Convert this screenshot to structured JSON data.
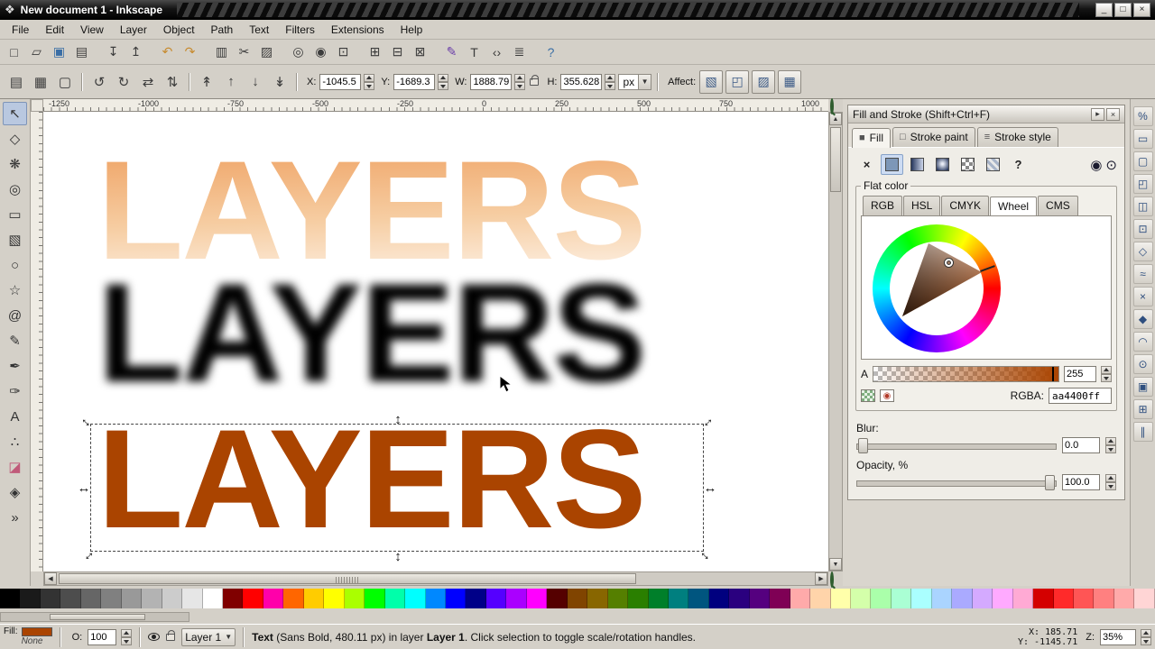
{
  "window": {
    "title": "New document 1 - Inkscape",
    "icon_glyph": "❖",
    "controls": [
      {
        "name": "minimize-button",
        "glyph": "_"
      },
      {
        "name": "restore-button",
        "glyph": "□"
      },
      {
        "name": "close-button",
        "glyph": "×"
      }
    ]
  },
  "menu": {
    "items": [
      {
        "name": "menu-file",
        "label": "File"
      },
      {
        "name": "menu-edit",
        "label": "Edit"
      },
      {
        "name": "menu-view",
        "label": "View"
      },
      {
        "name": "menu-layer",
        "label": "Layer"
      },
      {
        "name": "menu-object",
        "label": "Object"
      },
      {
        "name": "menu-path",
        "label": "Path"
      },
      {
        "name": "menu-text",
        "label": "Text"
      },
      {
        "name": "menu-filters",
        "label": "Filters"
      },
      {
        "name": "menu-extensions",
        "label": "Extensions"
      },
      {
        "name": "menu-help",
        "label": "Help"
      }
    ]
  },
  "toolbar1": {
    "items": [
      {
        "name": "new-document-button",
        "glyph": "□"
      },
      {
        "name": "open-button",
        "glyph": "▱"
      },
      {
        "name": "save-button",
        "glyph": "▣",
        "color": "#3a6ea5"
      },
      {
        "name": "print-button",
        "glyph": "▤"
      },
      {
        "name": "separator",
        "sep": true,
        "glyph": ""
      },
      {
        "name": "import-button",
        "glyph": "↧"
      },
      {
        "name": "export-button",
        "glyph": "↥"
      },
      {
        "name": "separator",
        "sep": true,
        "glyph": ""
      },
      {
        "name": "undo-button",
        "glyph": "↶",
        "color": "#c78a2d"
      },
      {
        "name": "redo-button",
        "glyph": "↷",
        "color": "#c78a2d"
      },
      {
        "name": "separator",
        "sep": true,
        "glyph": ""
      },
      {
        "name": "copy-button",
        "glyph": "▥"
      },
      {
        "name": "cut-button",
        "glyph": "✂"
      },
      {
        "name": "paste-button",
        "glyph": "▨"
      },
      {
        "name": "separator",
        "sep": true,
        "glyph": ""
      },
      {
        "name": "zoom-selection-button",
        "glyph": "◎"
      },
      {
        "name": "zoom-drawing-button",
        "glyph": "◉"
      },
      {
        "name": "zoom-page-button",
        "glyph": "⊡"
      },
      {
        "name": "separator",
        "sep": true,
        "glyph": ""
      },
      {
        "name": "duplicate-button",
        "glyph": "⊞"
      },
      {
        "name": "clone-button",
        "glyph": "⊟"
      },
      {
        "name": "unlink-clone-button",
        "glyph": "⊠"
      },
      {
        "name": "separator",
        "sep": true,
        "glyph": ""
      },
      {
        "name": "fill-stroke-dialog-button",
        "glyph": "✎",
        "color": "#6a3da8"
      },
      {
        "name": "text-dialog-button",
        "glyph": "T"
      },
      {
        "name": "xml-editor-button",
        "glyph": "‹›"
      },
      {
        "name": "align-dialog-button",
        "glyph": "≣"
      },
      {
        "name": "separator",
        "sep": true,
        "glyph": ""
      },
      {
        "name": "find-button",
        "glyph": "?",
        "color": "#3a6ea5"
      }
    ]
  },
  "toolbar2": {
    "icons_select": [
      {
        "name": "select-all-button",
        "glyph": "▤"
      },
      {
        "name": "select-all-layers-button",
        "glyph": "▦"
      },
      {
        "name": "deselect-button",
        "glyph": "▢"
      }
    ],
    "icons_rotate": [
      {
        "name": "rotate-ccw-button",
        "glyph": "↺"
      },
      {
        "name": "rotate-cw-button",
        "glyph": "↻"
      },
      {
        "name": "flip-horizontal-button",
        "glyph": "⇄"
      },
      {
        "name": "flip-vertical-button",
        "glyph": "⇅"
      }
    ],
    "icons_z": [
      {
        "name": "raise-to-top-button",
        "glyph": "↟"
      },
      {
        "name": "raise-button",
        "glyph": "↑"
      },
      {
        "name": "lower-button",
        "glyph": "↓"
      },
      {
        "name": "lower-to-bottom-button",
        "glyph": "↡"
      }
    ],
    "x_label": "X:",
    "x_value": "-1045.5",
    "y_label": "Y:",
    "y_value": "-1689.3",
    "w_label": "W:",
    "w_value": "1888.79",
    "h_label": "H:",
    "h_value": "355.628",
    "unit_value": "px",
    "affect_label": "Affect:",
    "affect_buttons": [
      {
        "name": "scale-stroke-toggle",
        "glyph": "▧"
      },
      {
        "name": "scale-corners-toggle",
        "glyph": "◰"
      },
      {
        "name": "move-gradients-toggle",
        "glyph": "▨"
      },
      {
        "name": "move-patterns-toggle",
        "glyph": "▦"
      }
    ]
  },
  "toolbox": {
    "items": [
      {
        "name": "selector-tool",
        "glyph": "↖",
        "selected": true
      },
      {
        "name": "node-tool",
        "glyph": "◇"
      },
      {
        "name": "tweak-tool",
        "glyph": "❋"
      },
      {
        "name": "zoom-tool",
        "glyph": "◎"
      },
      {
        "name": "rectangle-tool",
        "glyph": "▭"
      },
      {
        "name": "box3d-tool",
        "glyph": "▧"
      },
      {
        "name": "ellipse-tool",
        "glyph": "○"
      },
      {
        "name": "star-tool",
        "glyph": "☆"
      },
      {
        "name": "spiral-tool",
        "glyph": "@"
      },
      {
        "name": "pencil-tool",
        "glyph": "✎"
      },
      {
        "name": "bezier-tool",
        "glyph": "✒"
      },
      {
        "name": "calligraphy-tool",
        "glyph": "✑"
      },
      {
        "name": "text-tool",
        "glyph": "A"
      },
      {
        "name": "spray-tool",
        "glyph": "∴"
      },
      {
        "name": "eraser-tool",
        "glyph": "◪",
        "color": "#c05a7a"
      },
      {
        "name": "paint-bucket-tool",
        "glyph": "◈"
      },
      {
        "name": "more-tools-button",
        "glyph": "»"
      }
    ]
  },
  "ruler": {
    "top_labels": [
      "-1250",
      "-1000",
      "-750",
      "-500",
      "-250",
      "0",
      "250",
      "500",
      "750",
      "1000"
    ]
  },
  "canvas": {
    "text": "LAYERS",
    "selected_fill": "#aa4400",
    "handle_h": "↔",
    "handle_v": "↕",
    "handle_d": "↔"
  },
  "snapbar": {
    "items": [
      {
        "name": "snap-toggle-button",
        "glyph": "%"
      },
      {
        "name": "snap-bbox-button",
        "glyph": "▭"
      },
      {
        "name": "snap-bbox-edges-button",
        "glyph": "▢"
      },
      {
        "name": "snap-bbox-corners-button",
        "glyph": "◰"
      },
      {
        "name": "snap-bbox-midpoints-button",
        "glyph": "◫"
      },
      {
        "name": "snap-bbox-centers-button",
        "glyph": "⊡"
      },
      {
        "name": "snap-nodes-button",
        "glyph": "◇"
      },
      {
        "name": "snap-paths-button",
        "glyph": "≈"
      },
      {
        "name": "snap-intersections-button",
        "glyph": "×"
      },
      {
        "name": "snap-cusp-nodes-button",
        "glyph": "◆"
      },
      {
        "name": "snap-midpoints-button",
        "glyph": "◠"
      },
      {
        "name": "snap-centers-button",
        "glyph": "⊙"
      },
      {
        "name": "snap-page-button",
        "glyph": "▣"
      },
      {
        "name": "snap-grid-button",
        "glyph": "⊞"
      },
      {
        "name": "snap-guides-button",
        "glyph": "∥"
      }
    ]
  },
  "panel": {
    "title": "Fill and Stroke (Shift+Ctrl+F)",
    "buttons": [
      {
        "name": "dock-menu-button",
        "glyph": "▸"
      },
      {
        "name": "dock-close-button",
        "glyph": "×"
      }
    ],
    "tab_fill": "Fill",
    "tab_stroke_paint": "Stroke paint",
    "tab_stroke_style": "Stroke style",
    "fill_none_glyph": "×",
    "fill_unknown_glyph": "?",
    "fillrule_evenodd_glyph": "◉",
    "fillrule_nonzero_glyph": "⊙",
    "flat_color_label": "Flat color",
    "color_tabs": [
      "RGB",
      "HSL",
      "CMYK",
      "Wheel",
      "CMS"
    ],
    "alpha_label": "A",
    "alpha_value": "255",
    "rgba_label": "RGBA:",
    "rgba_value": "aa4400ff",
    "blur_label": "Blur:",
    "blur_value": "0.0",
    "opacity_label": "Opacity, %",
    "opacity_value": "100.0"
  },
  "palette": {
    "colors": [
      "#000000",
      "#1a1a1a",
      "#333333",
      "#4d4d4d",
      "#666666",
      "#808080",
      "#999999",
      "#b3b3b3",
      "#cccccc",
      "#e6e6e6",
      "#ffffff",
      "#800000",
      "#ff0000",
      "#ff00aa",
      "#ff6600",
      "#ffcc00",
      "#ffff00",
      "#aaff00",
      "#00ff00",
      "#00ffaa",
      "#00ffff",
      "#0088ff",
      "#0000ff",
      "#000088",
      "#5500ff",
      "#aa00ff",
      "#ff00ff",
      "#550000",
      "#804400",
      "#886600",
      "#557f00",
      "#2a7f00",
      "#007f2a",
      "#007f7f",
      "#00557f",
      "#00007f",
      "#2a007f",
      "#55007f",
      "#7f0055",
      "#ffaaaa",
      "#ffd4aa",
      "#ffffaa",
      "#d4ffaa",
      "#aaffaa",
      "#aaffd4",
      "#aaffff",
      "#aad4ff",
      "#aaaaff",
      "#d4aaff",
      "#ffaaff",
      "#ffaad4",
      "#d40000",
      "#ff2a2a",
      "#ff5555",
      "#ff8080",
      "#ffaaaa",
      "#ffd5d5"
    ]
  },
  "statusbar": {
    "fill_label": "Fill:",
    "stroke_value": "None",
    "opacity_label": "O:",
    "opacity_value": "100",
    "layer_name": "Layer 1",
    "msg_bold1": "Text",
    "msg_part1": " (Sans Bold, 480.11 px) in layer ",
    "msg_bold2": "Layer 1",
    "msg_part2": ". Click selection to toggle scale/rotation handles.",
    "x_label": "X:",
    "x_value": "185.71",
    "y_label": "Y:",
    "y_value": "-1145.71",
    "z_label": "Z:",
    "z_value": "35%"
  }
}
